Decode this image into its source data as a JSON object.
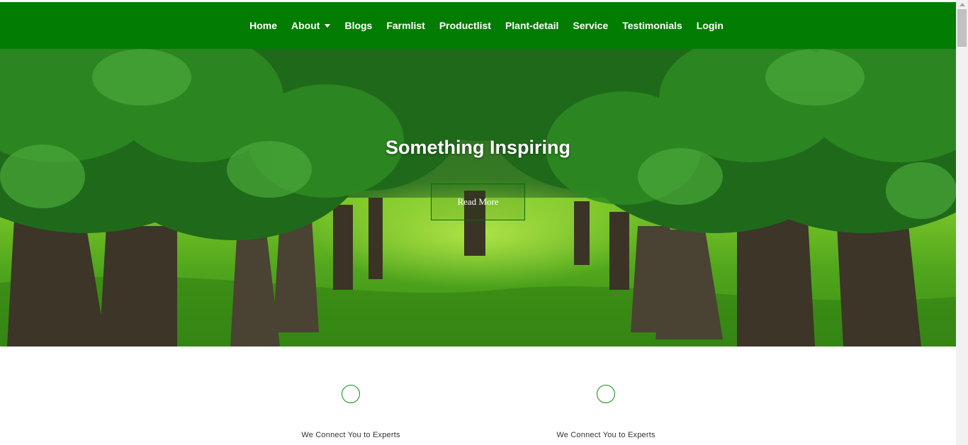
{
  "nav": {
    "items": [
      {
        "label": "Home"
      },
      {
        "label": "About",
        "has_dropdown": true
      },
      {
        "label": "Blogs"
      },
      {
        "label": "Farmlist"
      },
      {
        "label": "Productlist"
      },
      {
        "label": "Plant-detail"
      },
      {
        "label": "Service"
      },
      {
        "label": "Testimonials"
      },
      {
        "label": "Login"
      }
    ],
    "background_color": "#027d02"
  },
  "hero": {
    "title": "Something Inspiring",
    "button_label": "Read More"
  },
  "features": [
    {
      "icon": "circle-icon",
      "text": "We Connect You to Experts"
    },
    {
      "icon": "circle-icon",
      "text": "We Connect You to Experts"
    }
  ]
}
